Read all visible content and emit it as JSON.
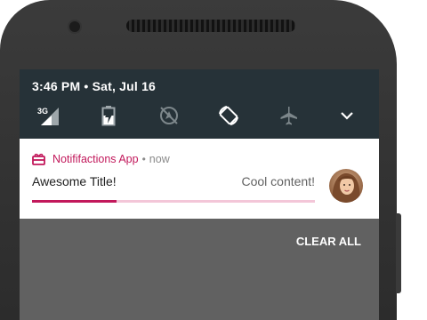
{
  "status_bar": {
    "time_date": "3:46 PM • Sat, Jul 16",
    "network_label": "3G"
  },
  "quick_settings": [
    {
      "icon": "signal-3g-icon"
    },
    {
      "icon": "battery-charging-icon"
    },
    {
      "icon": "location-off-icon"
    },
    {
      "icon": "auto-rotate-icon"
    },
    {
      "icon": "airplane-mode-icon"
    },
    {
      "icon": "chevron-down-icon"
    }
  ],
  "notification": {
    "app_name": "Notififactions App",
    "separator": "•",
    "time": "now",
    "title": "Awesome Title!",
    "content": "Cool content!",
    "progress": 0.3,
    "accent_color": "#c2185b",
    "track_color": "#f3c6d8"
  },
  "clear_all_label": "CLEAR ALL",
  "colors": {
    "status_bar_bg": "#263238",
    "shade_bg": "#616161",
    "phone_body": "#2e2e2e"
  }
}
